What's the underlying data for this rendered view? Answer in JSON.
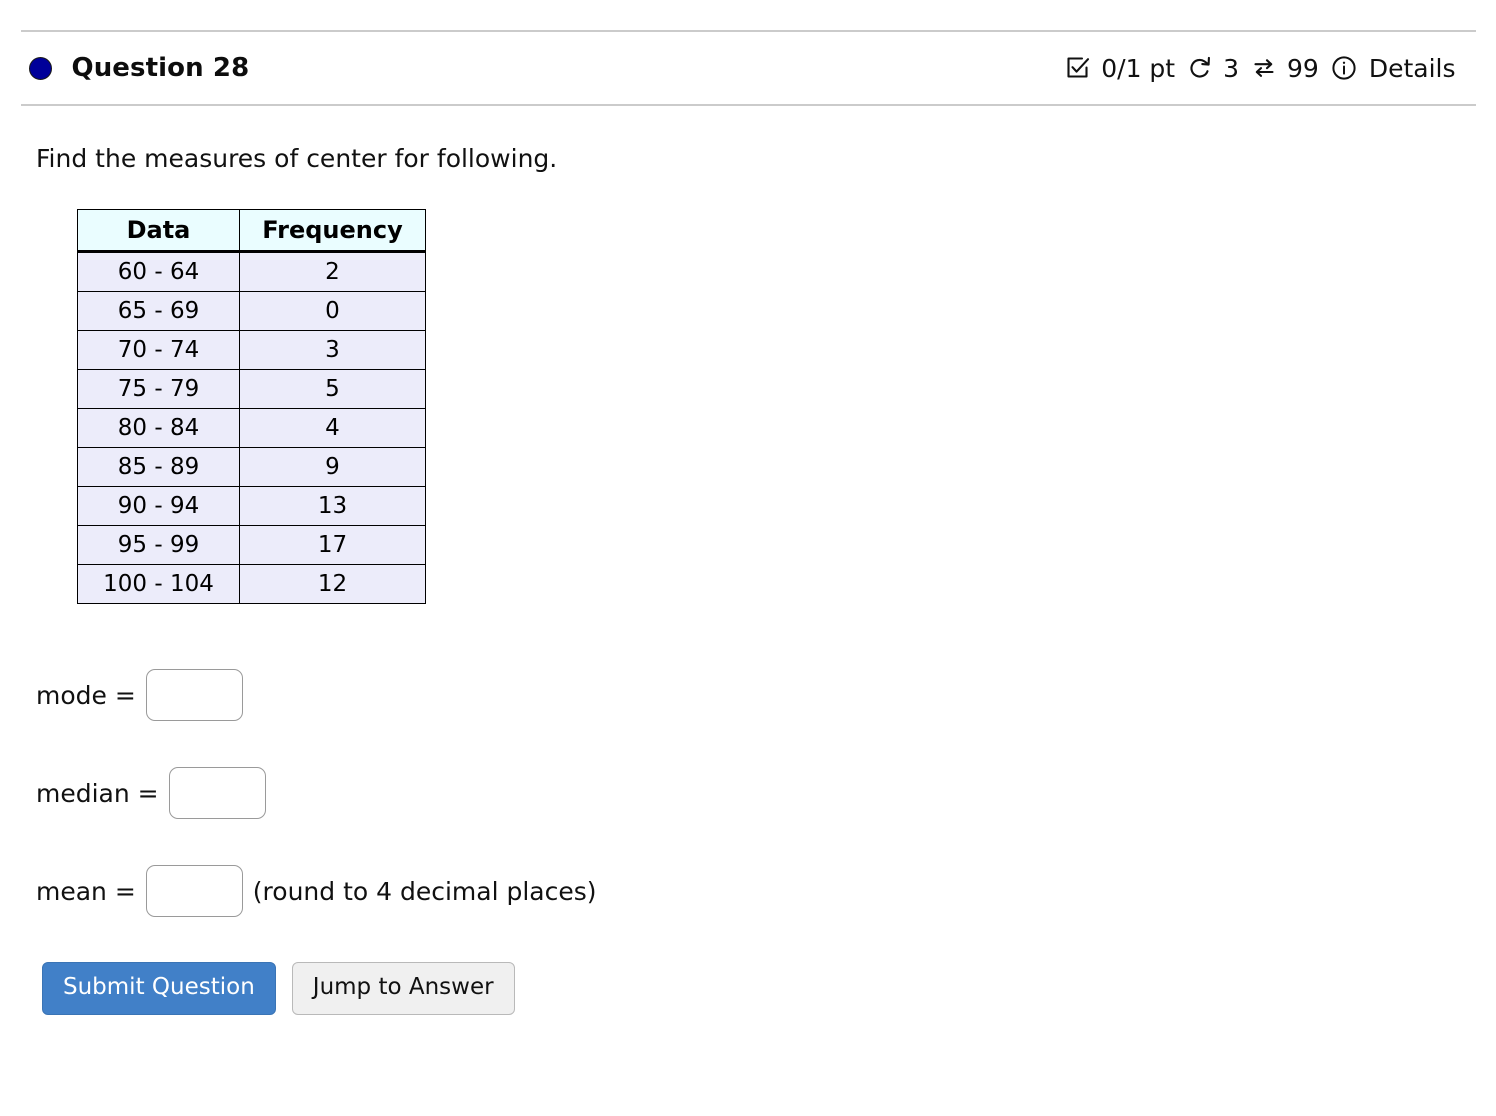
{
  "header": {
    "status_icon": "filled-circle-icon",
    "title": "Question 28",
    "metrics": {
      "points_icon": "checkbox-checked-icon",
      "points": "0/1 pt",
      "attempts_icon": "undo-arrow-icon",
      "attempts": "3",
      "exchanges_icon": "swap-arrows-icon",
      "exchanges": "99",
      "info_icon": "info-circle-icon",
      "details_label": "Details"
    }
  },
  "main": {
    "prompt": "Find the measures of center for following.",
    "table": {
      "columns": [
        "Data",
        "Frequency"
      ],
      "rows": [
        [
          "60 - 64",
          "2"
        ],
        [
          "65 - 69",
          "0"
        ],
        [
          "70 - 74",
          "3"
        ],
        [
          "75 - 79",
          "5"
        ],
        [
          "80 - 84",
          "4"
        ],
        [
          "85 - 89",
          "9"
        ],
        [
          "90 - 94",
          "13"
        ],
        [
          "95 - 99",
          "17"
        ],
        [
          "100 - 104",
          "12"
        ]
      ]
    },
    "answers": [
      {
        "label": "mode =",
        "value": "",
        "note": ""
      },
      {
        "label": "median =",
        "value": "",
        "note": ""
      },
      {
        "label": "mean =",
        "value": "",
        "note": "(round to 4 decimal places)"
      }
    ],
    "buttons": {
      "submit": "Submit Question",
      "jump": "Jump to Answer"
    }
  },
  "chart_data": {
    "type": "table",
    "title": "Find the measures of center for following.",
    "columns": [
      "Data",
      "Frequency"
    ],
    "categories": [
      "60 - 64",
      "65 - 69",
      "70 - 74",
      "75 - 79",
      "80 - 84",
      "85 - 89",
      "90 - 94",
      "95 - 99",
      "100 - 104"
    ],
    "values": [
      2,
      0,
      3,
      5,
      4,
      9,
      13,
      17,
      12
    ],
    "xlabel": "Data",
    "ylabel": "Frequency"
  },
  "colors": {
    "accent": "#4180c8",
    "status_dot": "#000099",
    "table_header_bg": "#eafdff",
    "table_row_bg": "#ececfa",
    "rule": "#cbcbcb"
  }
}
